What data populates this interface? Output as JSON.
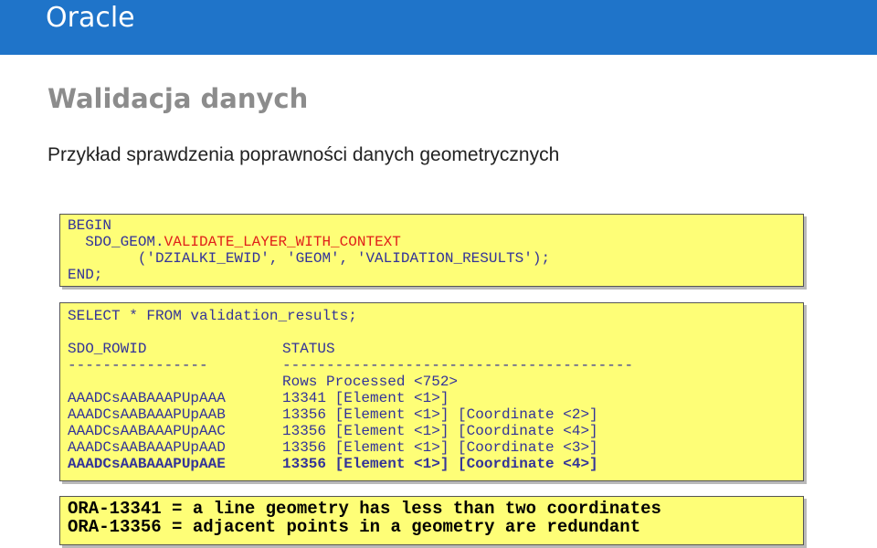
{
  "header": {
    "title": "Oracle"
  },
  "slide": {
    "title": "Walidacja danych",
    "subtitle": "Przykład sprawdzenia poprawności danych geometrycznych"
  },
  "plsql_block": {
    "line1": "BEGIN",
    "line2_prefix": "  SDO_GEOM.",
    "line2_highlight": "VALIDATE_LAYER_WITH_CONTEXT",
    "line3": "        ('DZIALKI_EWID', 'GEOM', 'VALIDATION_RESULTS');",
    "line4": "END;"
  },
  "query": {
    "statement": "SELECT * FROM validation_results;",
    "header_col1": "SDO_ROWID",
    "header_col2": "STATUS",
    "sep_col1": "----------------",
    "sep_col2": "----------------------------------------",
    "summary": "Rows Processed <752>",
    "rows": [
      {
        "rowid": "AAADCsAABAAAPUpAAA",
        "status": "13341 [Element <1>]"
      },
      {
        "rowid": "AAADCsAABAAAPUpAAB",
        "status": "13356 [Element <1>] [Coordinate <2>]"
      },
      {
        "rowid": "AAADCsAABAAAPUpAAC",
        "status": "13356 [Element <1>] [Coordinate <4>]"
      },
      {
        "rowid": "AAADCsAABAAAPUpAAD",
        "status": "13356 [Element <1>] [Coordinate <3>]"
      },
      {
        "rowid": "AAADCsAABAAAPUpAAE",
        "status": "13356 [Element <1>] [Coordinate <4>]"
      }
    ]
  },
  "errors": {
    "line1": "ORA-13341 = a line geometry has less than two coordinates",
    "line2": "ORA-13356 = adjacent points in a geometry are redundant"
  },
  "colors": {
    "header_bg": "#1f74c9",
    "code_bg": "#fefe77",
    "code_text": "#333399",
    "highlight": "#e0201a"
  }
}
